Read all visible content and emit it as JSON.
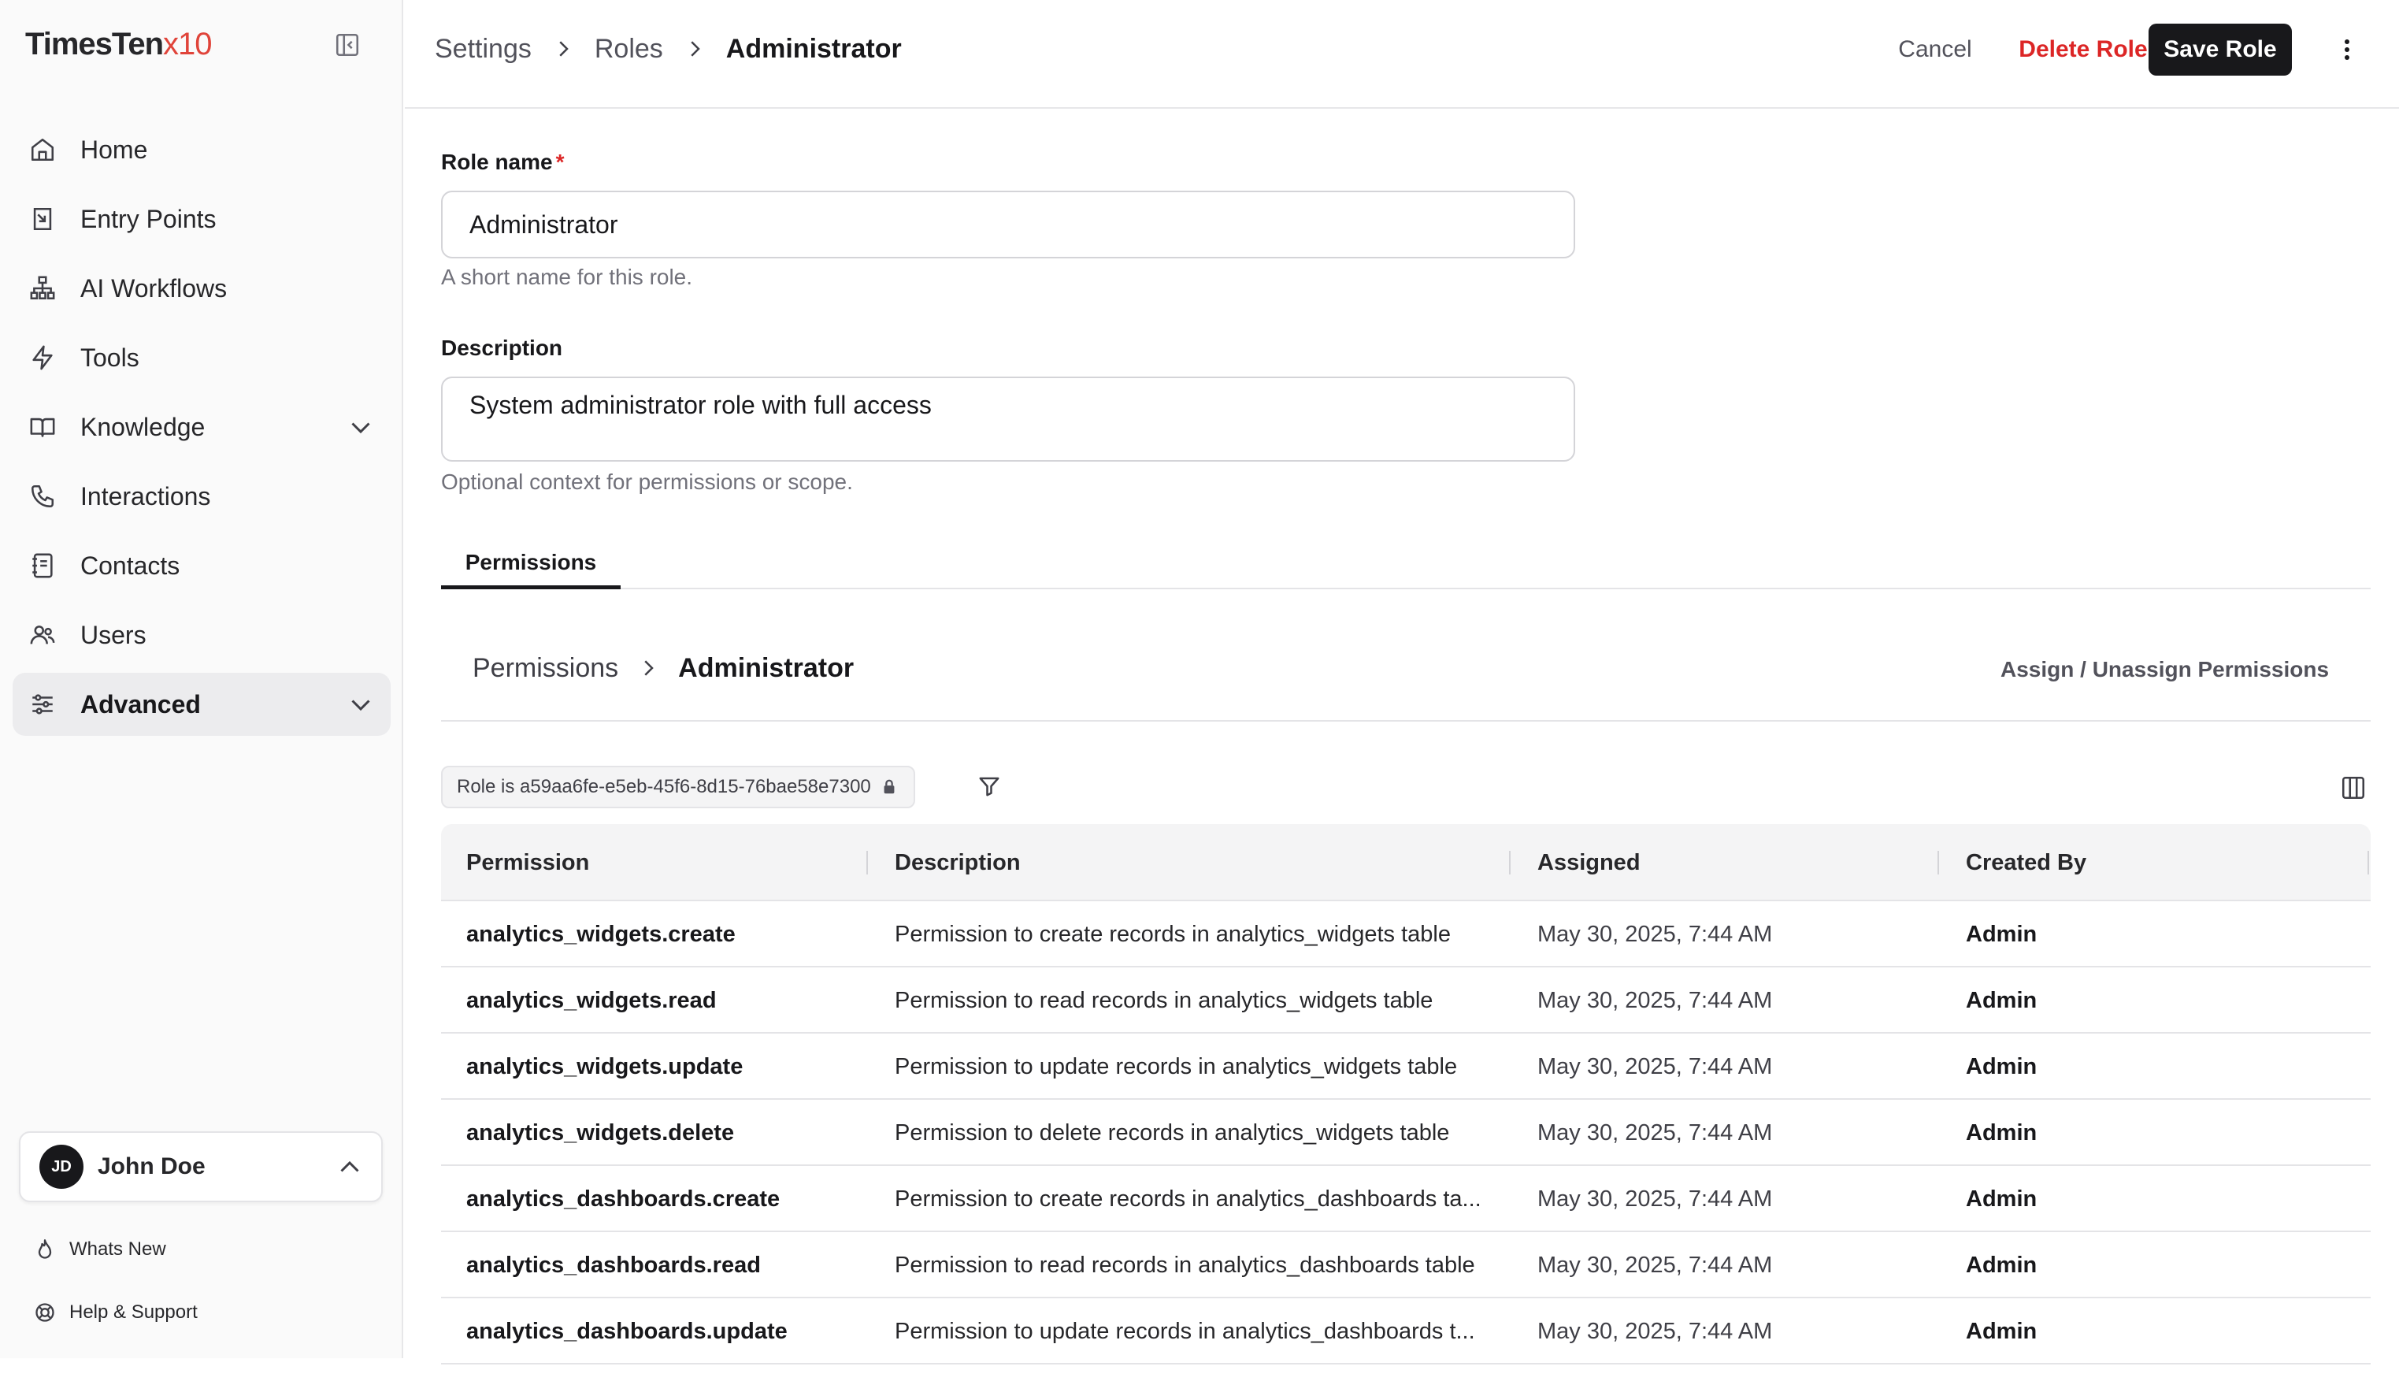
{
  "app": {
    "logo_main": "TimesTen",
    "logo_accent": "x10"
  },
  "sidebar": {
    "items": [
      {
        "label": "Home",
        "icon": "home-icon"
      },
      {
        "label": "Entry Points",
        "icon": "entry-points-icon"
      },
      {
        "label": "AI Workflows",
        "icon": "workflow-icon"
      },
      {
        "label": "Tools",
        "icon": "lightning-icon"
      },
      {
        "label": "Knowledge",
        "icon": "book-icon"
      },
      {
        "label": "Interactions",
        "icon": "phone-icon"
      },
      {
        "label": "Contacts",
        "icon": "contacts-icon"
      },
      {
        "label": "Users",
        "icon": "users-icon"
      },
      {
        "label": "Advanced",
        "icon": "sliders-icon"
      }
    ],
    "user": {
      "initials": "JD",
      "name": "John Doe"
    },
    "footer": {
      "whats_new": "Whats New",
      "help": "Help & Support"
    }
  },
  "header": {
    "breadcrumb": [
      "Settings",
      "Roles",
      "Administrator"
    ],
    "cancel": "Cancel",
    "delete": "Delete Role",
    "save": "Save Role"
  },
  "form": {
    "role_name_label": "Role name",
    "required_mark": "*",
    "role_name_value": "Administrator",
    "role_name_hint": "A short name for this role.",
    "description_label": "Description",
    "description_value": "System administrator role with full access",
    "description_hint": "Optional context for permissions or scope."
  },
  "tabs": {
    "permissions": "Permissions"
  },
  "permissions_panel": {
    "breadcrumb": [
      "Permissions",
      "Administrator"
    ],
    "assign_link": "Assign / Unassign Permissions",
    "filter_chip": "Role is a59aa6fe-e5eb-45f6-8d15-76bae58e7300",
    "columns": [
      "Permission",
      "Description",
      "Assigned",
      "Created By"
    ],
    "rows": [
      {
        "permission": "analytics_widgets.create",
        "description": "Permission to create records in analytics_widgets table",
        "assigned": "May 30, 2025, 7:44 AM",
        "created_by": "Admin"
      },
      {
        "permission": "analytics_widgets.read",
        "description": "Permission to read records in analytics_widgets table",
        "assigned": "May 30, 2025, 7:44 AM",
        "created_by": "Admin"
      },
      {
        "permission": "analytics_widgets.update",
        "description": "Permission to update records in analytics_widgets table",
        "assigned": "May 30, 2025, 7:44 AM",
        "created_by": "Admin"
      },
      {
        "permission": "analytics_widgets.delete",
        "description": "Permission to delete records in analytics_widgets table",
        "assigned": "May 30, 2025, 7:44 AM",
        "created_by": "Admin"
      },
      {
        "permission": "analytics_dashboards.create",
        "description": "Permission to create records in analytics_dashboards ta...",
        "assigned": "May 30, 2025, 7:44 AM",
        "created_by": "Admin"
      },
      {
        "permission": "analytics_dashboards.read",
        "description": "Permission to read records in analytics_dashboards table",
        "assigned": "May 30, 2025, 7:44 AM",
        "created_by": "Admin"
      },
      {
        "permission": "analytics_dashboards.update",
        "description": "Permission to update records in analytics_dashboards t...",
        "assigned": "May 30, 2025, 7:44 AM",
        "created_by": "Admin"
      }
    ]
  },
  "colors": {
    "accent": "#e0443a",
    "danger": "#dc2626",
    "primary": "#18181b"
  }
}
